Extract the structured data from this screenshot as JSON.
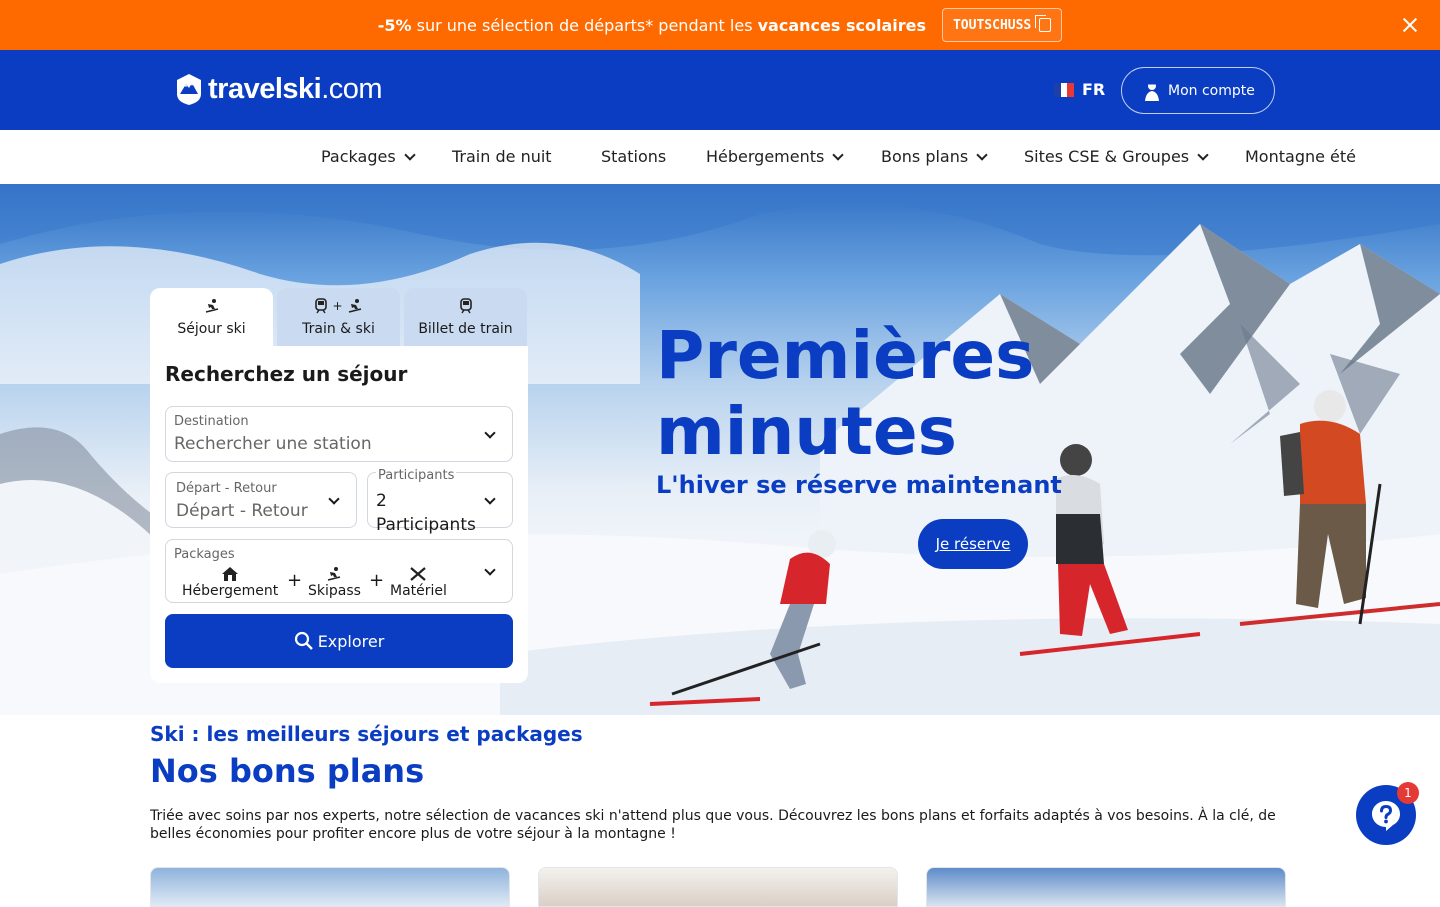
{
  "promo": {
    "discount": "-5%",
    "text_middle": " sur une sélection de départs* pendant les ",
    "text_bold": "vacances scolaires",
    "code": "TOUTSCHUSS"
  },
  "header": {
    "logo_bold": "travelski",
    "logo_light": ".com",
    "lang": "FR",
    "account_label": "Mon compte"
  },
  "nav": {
    "items": [
      {
        "label": "Packages"
      },
      {
        "label": "Train de nuit"
      },
      {
        "label": "Stations"
      },
      {
        "label": "Hébergements"
      },
      {
        "label": "Bons plans"
      },
      {
        "label": "Sites CSE & Groupes"
      },
      {
        "label": "Montagne été"
      }
    ],
    "glyph": ""
  },
  "hero": {
    "title_line1": "Premières",
    "title_line2": "minutes",
    "subtitle": "L'hiver se réserve maintenant",
    "cta": "Je réserve"
  },
  "search": {
    "tabs": [
      {
        "label": "Séjour ski",
        "active": true
      },
      {
        "label": "Train & ski",
        "active": false
      },
      {
        "label": "Billet de train",
        "active": false
      }
    ],
    "tab_plus": "+",
    "title": "Recherchez un séjour",
    "destination": {
      "label": "Destination",
      "placeholder": "Rechercher une station"
    },
    "dates": {
      "label": "Départ - Retour",
      "placeholder": "Départ - Retour"
    },
    "participants": {
      "label": "Participants",
      "value_line1": "2",
      "value_line2": "Participants"
    },
    "packages": {
      "label": "Packages",
      "items": [
        "Hébergement",
        "Skipass",
        "Matériel"
      ],
      "separator": "+"
    },
    "explore": "Explorer"
  },
  "content": {
    "kicker": "Ski : les meilleurs séjours et packages",
    "heading": "Nos bons plans",
    "description": "Triée avec soins par nos experts, notre sélection de vacances ski n'attend plus que vous. Découvrez les bons plans et forfaits adaptés à vos besoins. À la clé, de belles économies pour profiter encore plus de votre séjour à la montagne !"
  },
  "chat": {
    "badge": "1"
  },
  "colors": {
    "promo": "#ff6a00",
    "brand": "#0a3dc2",
    "tab_inactive": "#c9daf1"
  }
}
